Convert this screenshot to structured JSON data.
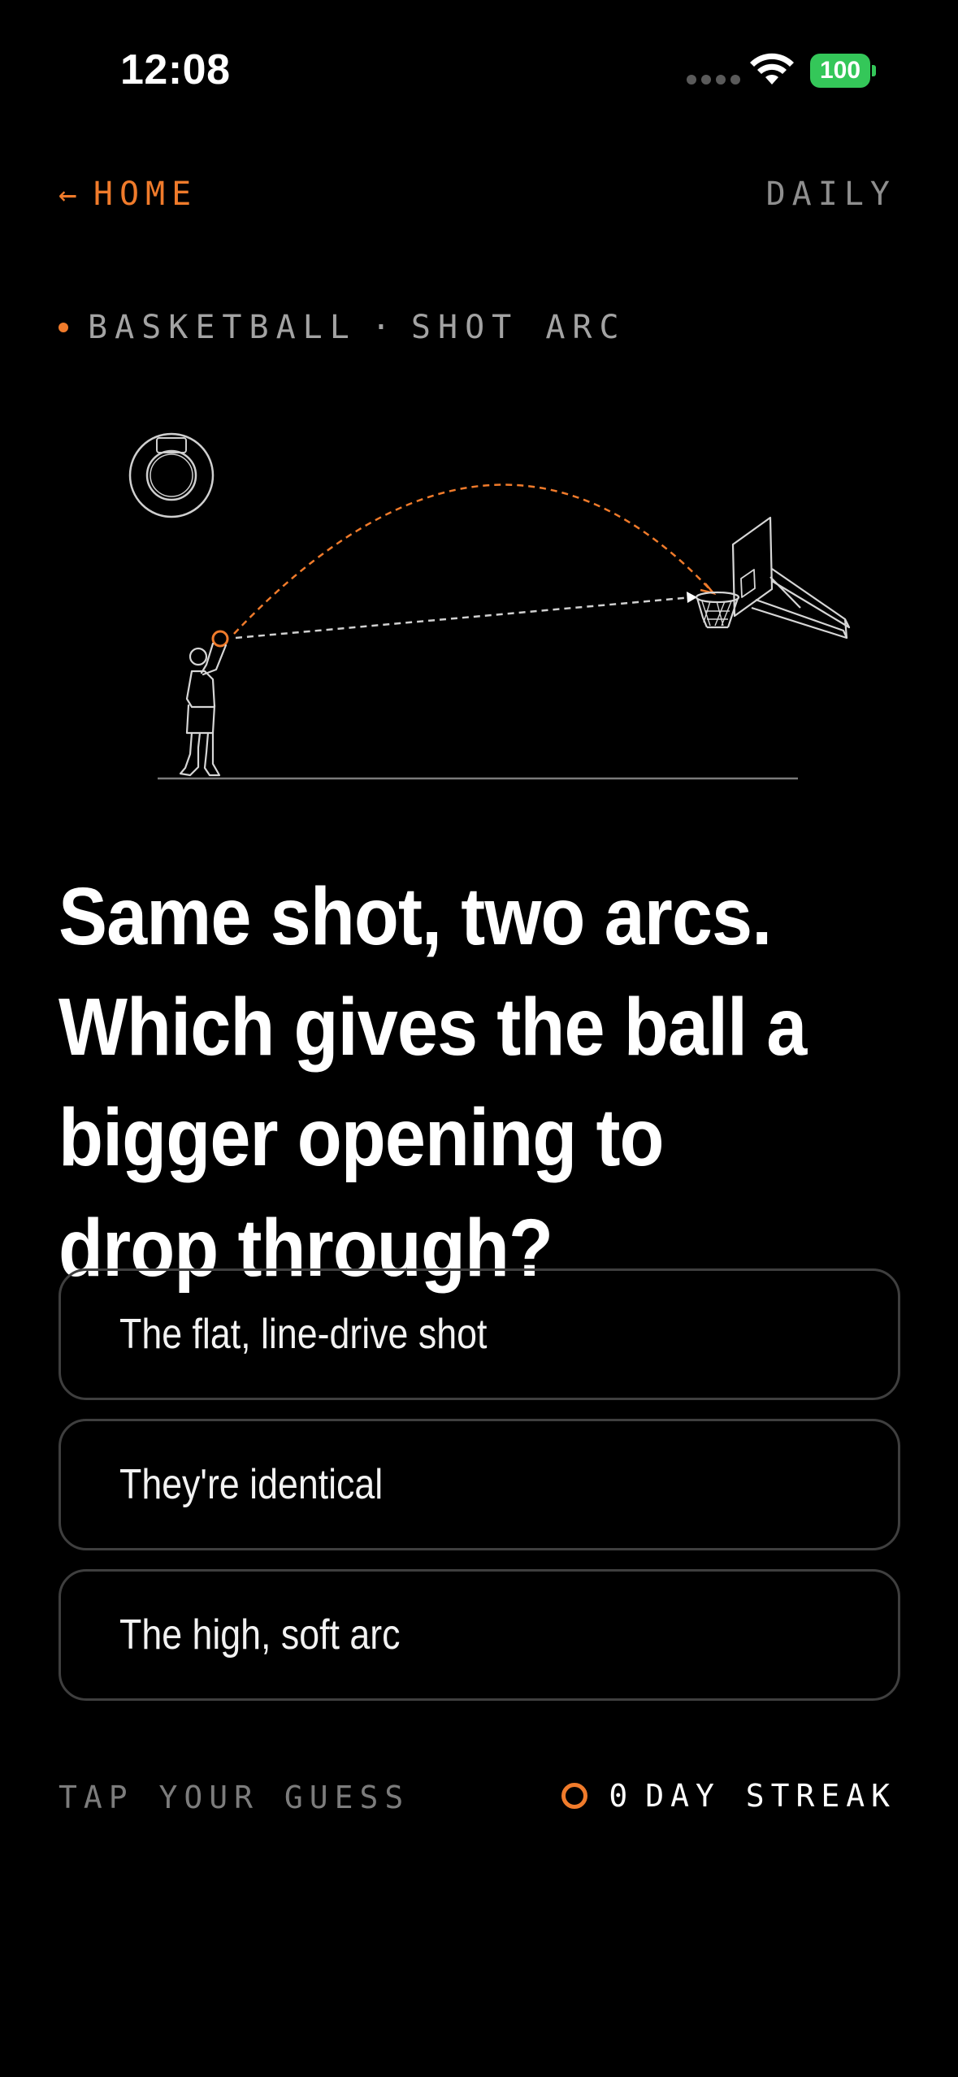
{
  "status_bar": {
    "time": "12:08",
    "battery": "100",
    "battery_color": "#34c759"
  },
  "nav": {
    "back_arrow": "←",
    "home_label": "HOME",
    "daily_label": "DAILY"
  },
  "category": {
    "sport": "BASKETBALL",
    "separator": "·",
    "topic": "SHOT ARC"
  },
  "question": "Same shot, two arcs. Which gives the ball a bigger opening to drop through?",
  "options": [
    {
      "label": "The flat, line-drive shot"
    },
    {
      "label": "They're identical"
    },
    {
      "label": "The high, soft arc"
    }
  ],
  "footer": {
    "instruction": "TAP YOUR GUESS",
    "streak_count": "0",
    "streak_label": "DAY STREAK"
  },
  "colors": {
    "accent": "#f07b2b",
    "background": "#000000",
    "border": "#3f3f3f"
  },
  "icons": [
    "wifi-icon",
    "back-arrow-icon",
    "hoop-top-view-icon",
    "player-shooting-icon",
    "backboard-hoop-icon",
    "streak-ring-icon"
  ]
}
